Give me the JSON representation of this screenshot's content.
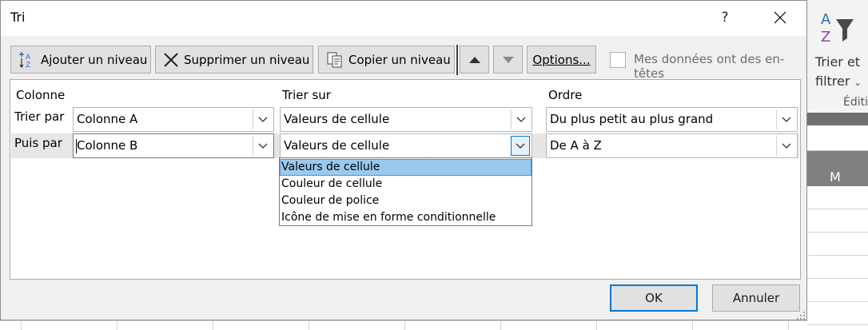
{
  "dialog": {
    "title": "Tri",
    "help_label": "?",
    "toolbar": {
      "add_level": "Ajouter un niveau",
      "delete_level": "Supprimer un niveau",
      "copy_level": "Copier un niveau",
      "options": "Options...",
      "headers_checkbox_label": "Mes données ont des en-têtes",
      "headers_checked": false
    },
    "columns": {
      "column": "Colonne",
      "sort_on": "Trier sur",
      "order": "Ordre"
    },
    "rows": [
      {
        "label": "Trier par",
        "column": "Colonne A",
        "sort_on": "Valeurs de cellule",
        "order": "Du plus petit au plus grand"
      },
      {
        "label": "Puis par",
        "column": "Colonne B",
        "sort_on": "Valeurs de cellule",
        "order": "De A à Z"
      }
    ],
    "sort_on_dropdown": {
      "options": [
        "Valeurs de cellule",
        "Couleur de cellule",
        "Couleur de police",
        "Icône de mise en forme conditionnelle"
      ],
      "selected_index": 0
    },
    "ok_label": "OK",
    "cancel_label": "Annuler"
  },
  "background": {
    "ribbon_button_line1": "Trier et",
    "ribbon_button_line2": "filtrer",
    "group_label": "Éditi",
    "column_header": "M"
  },
  "colors": {
    "accent": "#0078d7",
    "selection": "#99c9ef",
    "dialog_bg": "#f0f0f0",
    "header_dark": "#808080"
  }
}
